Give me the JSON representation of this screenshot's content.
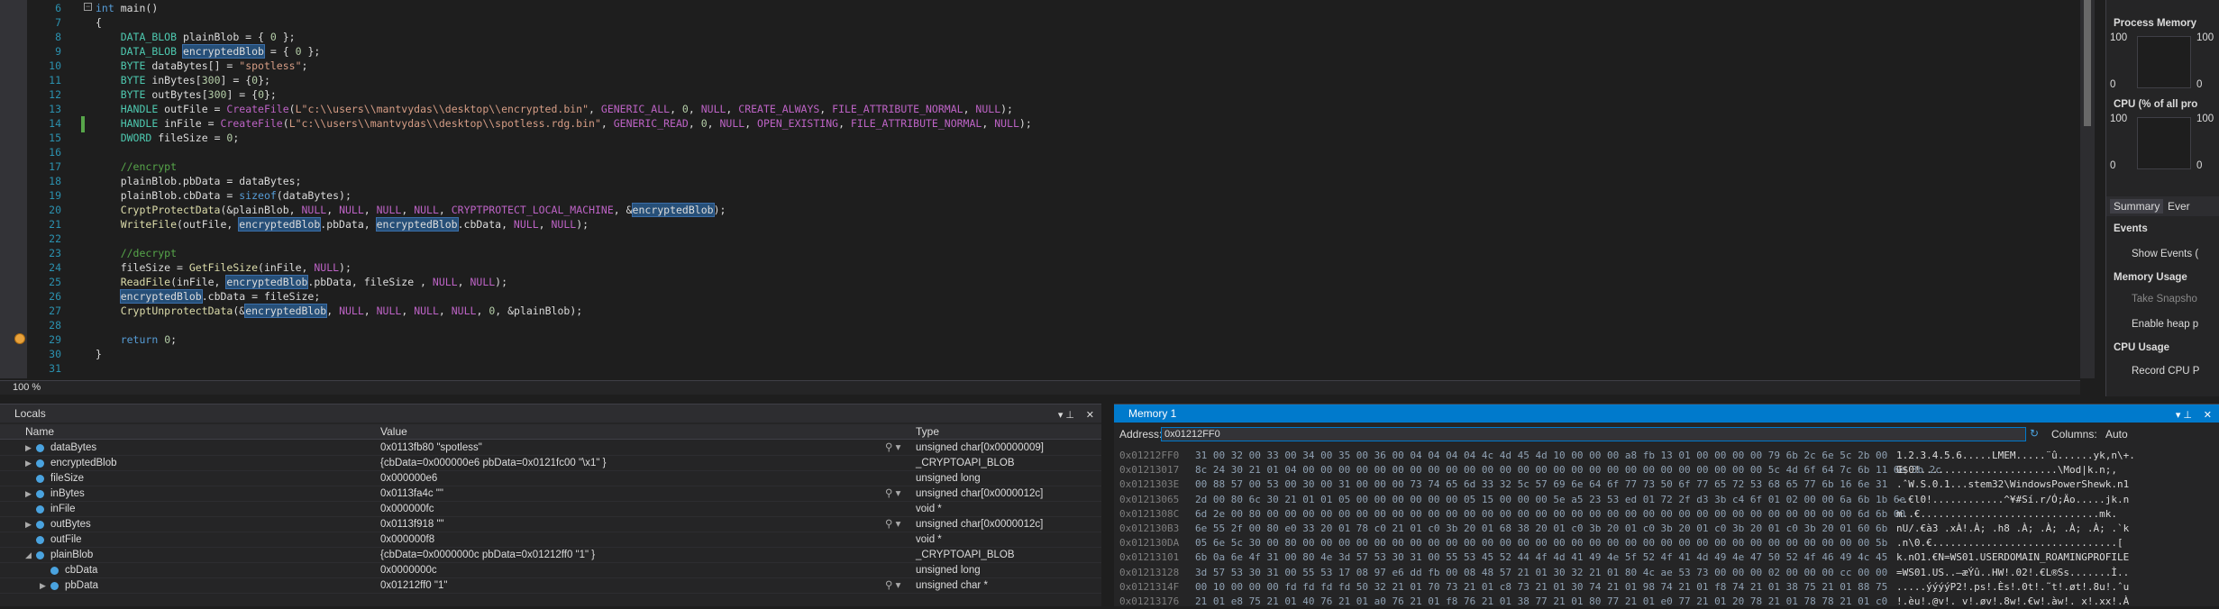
{
  "code": {
    "lines": [
      {
        "n": "6",
        "h": "<span class='kw'>int</span> main()"
      },
      {
        "n": "7",
        "h": "{"
      },
      {
        "n": "8",
        "h": "    <span class='ty'>DATA_BLOB</span> plainBlob = { <span class='nm'>0</span> };"
      },
      {
        "n": "9",
        "h": "    <span class='ty'>DATA_BLOB</span> <span class='hl'>encryptedBlob</span> = { <span class='nm'>0</span> };"
      },
      {
        "n": "10",
        "h": "    <span class='ty'>BYTE</span> dataBytes[] = <span class='st'>\"spotless\"</span>;"
      },
      {
        "n": "11",
        "h": "    <span class='ty'>BYTE</span> inBytes[<span class='nm'>300</span>] = {<span class='nm'>0</span>};"
      },
      {
        "n": "12",
        "h": "    <span class='ty'>BYTE</span> outBytes[<span class='nm'>300</span>] = {<span class='nm'>0</span>};"
      },
      {
        "n": "13",
        "h": "    <span class='ty'>HANDLE</span> outFile = <span class='mc'>CreateFile</span>(<span class='st'>L\"c:\\\\users\\\\mantvydas\\\\desktop\\\\encrypted.bin\"</span>, <span class='mc'>GENERIC_ALL</span>, <span class='nm'>0</span>, <span class='mc'>NULL</span>, <span class='mc'>CREATE_ALWAYS</span>, <span class='mc'>FILE_ATTRIBUTE_NORMAL</span>, <span class='mc'>NULL</span>);"
      },
      {
        "n": "14",
        "h": "    <span class='ty'>HANDLE</span> inFile = <span class='mc'>CreateFile</span>(<span class='st'>L\"c:\\\\users\\\\mantvydas\\\\desktop\\\\spotless.rdg.bin\"</span>, <span class='mc'>GENERIC_READ</span>, <span class='nm'>0</span>, <span class='mc'>NULL</span>, <span class='mc'>OPEN_EXISTING</span>, <span class='mc'>FILE_ATTRIBUTE_NORMAL</span>, <span class='mc'>NULL</span>);"
      },
      {
        "n": "15",
        "h": "    <span class='ty'>DWORD</span> fileSize = <span class='nm'>0</span>;"
      },
      {
        "n": "16",
        "h": ""
      },
      {
        "n": "17",
        "h": "    <span class='cm'>//encrypt</span>"
      },
      {
        "n": "18",
        "h": "    plainBlob.pbData = dataBytes;"
      },
      {
        "n": "19",
        "h": "    plainBlob.cbData = <span class='kw'>sizeof</span>(dataBytes);"
      },
      {
        "n": "20",
        "h": "    <span class='fn'>CryptProtectData</span>(&amp;plainBlob, <span class='mc'>NULL</span>, <span class='mc'>NULL</span>, <span class='mc'>NULL</span>, <span class='mc'>NULL</span>, <span class='mc'>CRYPTPROTECT_LOCAL_MACHINE</span>, &amp;<span class='hl'>encryptedBlob</span>);"
      },
      {
        "n": "21",
        "h": "    <span class='fn'>WriteFile</span>(outFile, <span class='hl'>encryptedBlob</span>.pbData, <span class='hl'>encryptedBlob</span>.cbData, <span class='mc'>NULL</span>, <span class='mc'>NULL</span>);"
      },
      {
        "n": "22",
        "h": ""
      },
      {
        "n": "23",
        "h": "    <span class='cm'>//decrypt</span>"
      },
      {
        "n": "24",
        "h": "    fileSize = <span class='fn'>GetFileSize</span>(inFile, <span class='mc'>NULL</span>);"
      },
      {
        "n": "25",
        "h": "    <span class='fn'>ReadFile</span>(inFile, <span class='hl'>encryptedBlob</span>.pbData, fileSize , <span class='mc'>NULL</span>, <span class='mc'>NULL</span>);"
      },
      {
        "n": "26",
        "h": "    <span class='hl'>encryptedBlob</span>.cbData = fileSize;"
      },
      {
        "n": "27",
        "h": "    <span class='fn'>CryptUnprotectData</span>(&amp;<span class='hl'>encryptedBlob</span>, <span class='mc'>NULL</span>, <span class='mc'>NULL</span>, <span class='mc'>NULL</span>, <span class='mc'>NULL</span>, <span class='nm'>0</span>, &amp;plainBlob);"
      },
      {
        "n": "28",
        "h": ""
      },
      {
        "n": "29",
        "h": "    <span class='kw'>return</span> <span class='nm'>0</span>;"
      },
      {
        "n": "30",
        "h": "}"
      },
      {
        "n": "31",
        "h": ""
      }
    ]
  },
  "zoom": "100 %",
  "side": {
    "process_memory": "Process Memory",
    "cpu": "CPU (% of all pro",
    "g100a": "100",
    "g0a": "0",
    "g100b": "100",
    "g0b": "0",
    "g100c": "100",
    "g0c": "0",
    "g100d": "100",
    "g0d": "0",
    "tab_summary": "Summary",
    "tab_events": "Ever",
    "events": "Events",
    "show_events": "Show Events (",
    "memory_usage": "Memory Usage",
    "take_snapshot": "Take Snapsho",
    "enable_heap": "Enable heap p",
    "cpu_usage": "CPU Usage",
    "record_cpu": "Record CPU P"
  },
  "locals": {
    "title": "Locals",
    "col_name": "Name",
    "col_value": "Value",
    "col_type": "Type",
    "rows": [
      {
        "name": "dataBytes",
        "value": "0x0113fb80 \"spotless\"",
        "type": "unsigned char[0x00000009]",
        "exp": "▶",
        "mag": true
      },
      {
        "name": "encryptedBlob",
        "value": "{cbData=0x000000e6 pbData=0x0121fc00 \"\\x1\" }",
        "type": "_CRYPTOAPI_BLOB",
        "exp": "▶",
        "mag": false
      },
      {
        "name": "fileSize",
        "value": "0x000000e6",
        "type": "unsigned long",
        "exp": "",
        "mag": false
      },
      {
        "name": "inBytes",
        "value": "0x0113fa4c \"\"",
        "type": "unsigned char[0x0000012c]",
        "exp": "▶",
        "mag": true
      },
      {
        "name": "inFile",
        "value": "0x000000fc",
        "type": "void *",
        "exp": "",
        "mag": false
      },
      {
        "name": "outBytes",
        "value": "0x0113f918 \"\"",
        "type": "unsigned char[0x0000012c]",
        "exp": "▶",
        "mag": true
      },
      {
        "name": "outFile",
        "value": "0x000000f8",
        "type": "void *",
        "exp": "",
        "mag": false
      },
      {
        "name": "plainBlob",
        "value": "{cbData=0x0000000c pbData=0x01212ff0 \"1\" }",
        "type": "_CRYPTOAPI_BLOB",
        "exp": "◢",
        "mag": false
      },
      {
        "name": "cbData",
        "value": "0x0000000c",
        "type": "unsigned long",
        "exp": "",
        "mag": false,
        "indent": 1
      },
      {
        "name": "pbData",
        "value": "0x01212ff0 \"1\"",
        "type": "unsigned char *",
        "exp": "▶",
        "mag": true,
        "indent": 1
      }
    ]
  },
  "memory": {
    "title": "Memory 1",
    "address_label": "Address:",
    "address": "0x01212FF0",
    "columns_label": "Columns:",
    "columns_value": "Auto",
    "rows": [
      {
        "a": "0x01212FF0",
        "h": "31 00 32 00 33 00 34 00 35 00 36 00 04 04 04 04 4c 4d 45 4d 10 00 00 00 a8 fb 13 01 00 00 00 00 79 6b 2c 6e 5c 2b 00",
        "t": "1.2.3.4.5.6.....LMEM.....¨û......yk,n\\+."
      },
      {
        "a": "0x01213017",
        "h": "8c 24 30 21 01 04 00 00 00 00 00 00 00 00 00 00 00 00 00 00 00 00 00 00 00 00 00 00 00 00 00 00 5c 4d 6f 64 7c 6b 11 6e 3b 2c",
        "t": "Œ$0!.......................\\Mod|k.n;,"
      },
      {
        "a": "0x0121303E",
        "h": "00 88 57 00 53 00 30 00 31 00 00 00 73 74 65 6d 33 32 5c 57 69 6e 64 6f 77 73 50 6f 77 65 72 53 68 65 77 6b 16 6e 31",
        "t": ".ˆW.S.0.1...stem32\\WindowsPowerShewk.n1"
      },
      {
        "a": "0x01213065",
        "h": "2d 00 80 6c 30 21 01 01 05 00 00 00 00 00 00 05 15 00 00 00 5e a5 23 53 ed 01 72 2f d3 3b c4 6f 01 02 00 00 6a 6b 1b 6e",
        "t": "-.€l0!............^¥#Sí.r/Ó;Äo.....jk.n"
      },
      {
        "a": "0x0121308C",
        "h": "6d 2e 00 80 00 00 00 00 00 00 00 00 00 00 00 00 00 00 00 00 00 00 00 00 00 00 00 00 00 00 00 00 00 00 00 00 00 6d 6b 00",
        "t": "m..€..............................mk."
      },
      {
        "a": "0x012130B3",
        "h": "6e 55 2f 00 80 e0 33 20 01 78 c0 21 01 c0 3b 20 01 68 38 20 01 c0 3b 20 01 c0 3b 20 01 c0 3b 20 01 c0 3b 20 01 60 6b",
        "t": "nU/.€à3 .xÀ!.À; .h8 .À; .À; .À; .À; .`k"
      },
      {
        "a": "0x012130DA",
        "h": "05 6e 5c 30 00 80 00 00 00 00 00 00 00 00 00 00 00 00 00 00 00 00 00 00 00 00 00 00 00 00 00 00 00 00 00 00 00 00 5b",
        "t": ".n\\0.€...............................["
      },
      {
        "a": "0x01213101",
        "h": "6b 0a 6e 4f 31 00 80 4e 3d 57 53 30 31 00 55 53 45 52 44 4f 4d 41 49 4e 5f 52 4f 41 4d 49 4e 47 50 52 4f 46 49 4c 45",
        "t": "k.nO1.€N=WS01.USERDOMAIN_ROAMINGPROFILE"
      },
      {
        "a": "0x01213128",
        "h": "3d 57 53 30 31 00 55 53 17 08 97 e6 dd fb 00 08 48 57 21 01 30 32 21 01 80 4c ae 53 73 00 00 00 02 00 00 00 cc 00 00",
        "t": "=WS01.US..—æÝû..HW!.02!.€L®Ss.......Ì.."
      },
      {
        "a": "0x0121314F",
        "h": "00 10 00 00 00 fd fd fd fd 50 32 21 01 70 73 21 01 c8 73 21 01 30 74 21 01 98 74 21 01 f8 74 21 01 38 75 21 01 88 75",
        "t": ".....ýýýýP2!.ps!.Ès!.0t!.˜t!.øt!.8u!.ˆu"
      },
      {
        "a": "0x01213176",
        "h": "21 01 e8 75 21 01 40 76 21 01 a0 76 21 01 f8 76 21 01 38 77 21 01 80 77 21 01 e0 77 21 01 20 78 21 01 78 78 21 01 c0",
        "t": "!.èu!.@v!. v!.øv!.8w!.€w!.àw!. x!.xx!.À"
      }
    ]
  }
}
